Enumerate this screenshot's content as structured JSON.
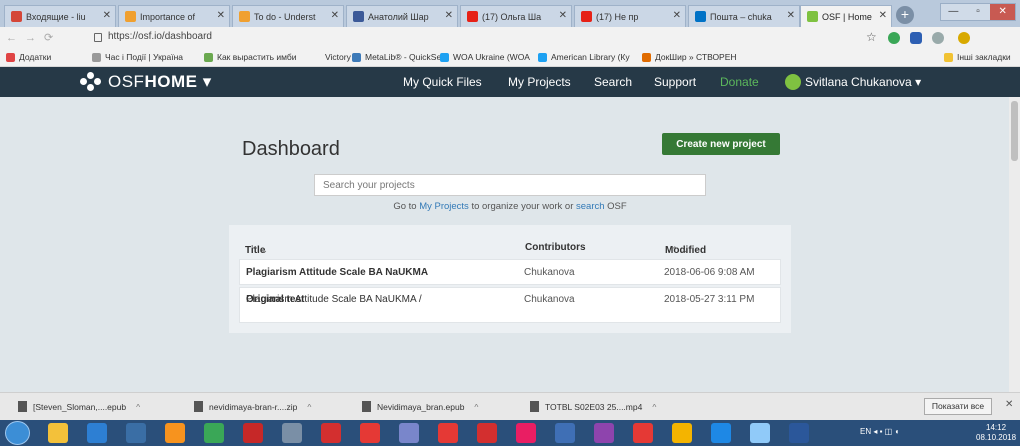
{
  "browser": {
    "tabs": [
      {
        "label": "Входящие - liu",
        "color": "#d44638",
        "active": false
      },
      {
        "label": "Importance of",
        "color": "#f0a030",
        "active": false
      },
      {
        "label": "To do - Underst",
        "color": "#f0a030",
        "active": false
      },
      {
        "label": "Анатолий Шар",
        "color": "#3b5998",
        "active": false
      },
      {
        "label": "(17) Ольга Ша",
        "color": "#e62117",
        "active": false
      },
      {
        "label": "(17) Не пр",
        "color": "#e62117",
        "active": false
      },
      {
        "label": "Пошта – chuka",
        "color": "#0072c6",
        "active": false
      },
      {
        "label": "OSF | Home",
        "color": "#7fc241",
        "active": true
      }
    ],
    "new_tab": "+",
    "window_controls": [
      "—",
      "▫",
      "✕"
    ],
    "url": "https://osf.io/dashboard",
    "bookmarks": [
      {
        "label": "Додатки",
        "color": "#e04444"
      },
      {
        "label": "Час і Події | Україна",
        "color": "#999999"
      },
      {
        "label": "Как вырастить имби",
        "color": "#6aa84f"
      },
      {
        "label": "Victory",
        "color": "#f2f2f2"
      },
      {
        "label": "MetaLib® - QuickSe",
        "color": "#3d7ab8"
      },
      {
        "label": "WOA Ukraine (WOA",
        "color": "#1da1f2"
      },
      {
        "label": "American Library (Ку",
        "color": "#1da1f2"
      },
      {
        "label": "ДокШир » СТВОРЕН",
        "color": "#e06b00"
      },
      {
        "label": "Інші закладки",
        "color": "#f1c232"
      }
    ]
  },
  "osf_nav": {
    "logo_text_light": "OSF",
    "logo_text_bold": "HOME",
    "caret": "▾",
    "items": [
      "My Quick Files",
      "My Projects",
      "Search",
      "Support",
      "Donate"
    ],
    "user": "Svitlana Chukanova ▾"
  },
  "dashboard": {
    "title": "Dashboard",
    "create_button": "Create new project",
    "search_placeholder": "Search your projects",
    "hint_prefix": "Go to ",
    "hint_link1": "My Projects",
    "hint_mid": " to organize your work or ",
    "hint_link2": "search",
    "hint_suffix": " OSF",
    "table": {
      "headers": {
        "title": "Title",
        "contributors": "Contributors",
        "modified": "Modified"
      },
      "sort_arrows": "⌃⌄",
      "rows": [
        {
          "title_prefix": "",
          "title_bold": "Plagiarism Attitude Scale BA NaUKMA",
          "contributors": "Chukanova",
          "modified": "2018-06-06 9:08 AM"
        },
        {
          "title_prefix": "Plagiarism Attitude Scale BA NaUKMA / ",
          "title_bold": "Original test",
          "contributors": "Chukanova",
          "modified": "2018-05-27 3:11 PM"
        }
      ]
    }
  },
  "downloads": {
    "items": [
      "[Steven_Sloman,....epub",
      "nevidimaya-bran-r....zip",
      "Nevidimaya_bran.epub",
      "TOTBL S02E03 25....mp4"
    ],
    "show_all": "Показати все",
    "close": "✕"
  },
  "taskbar": {
    "icons": [
      "#f3c13a",
      "#2d7fd3",
      "#3a6ea5",
      "#f7931e",
      "#3aa757",
      "#c62828",
      "#7a8fa6",
      "#d32f2f",
      "#e53935",
      "#7986cb",
      "#e53935",
      "#d32f2f",
      "#e91e63",
      "#3f6fb5",
      "#8e44ad",
      "#e53935",
      "#f4b400",
      "#1e88e5",
      "#90caf9",
      "#2b579a"
    ],
    "lang": "EN",
    "time": "14:12",
    "date": "08.10.2018"
  }
}
